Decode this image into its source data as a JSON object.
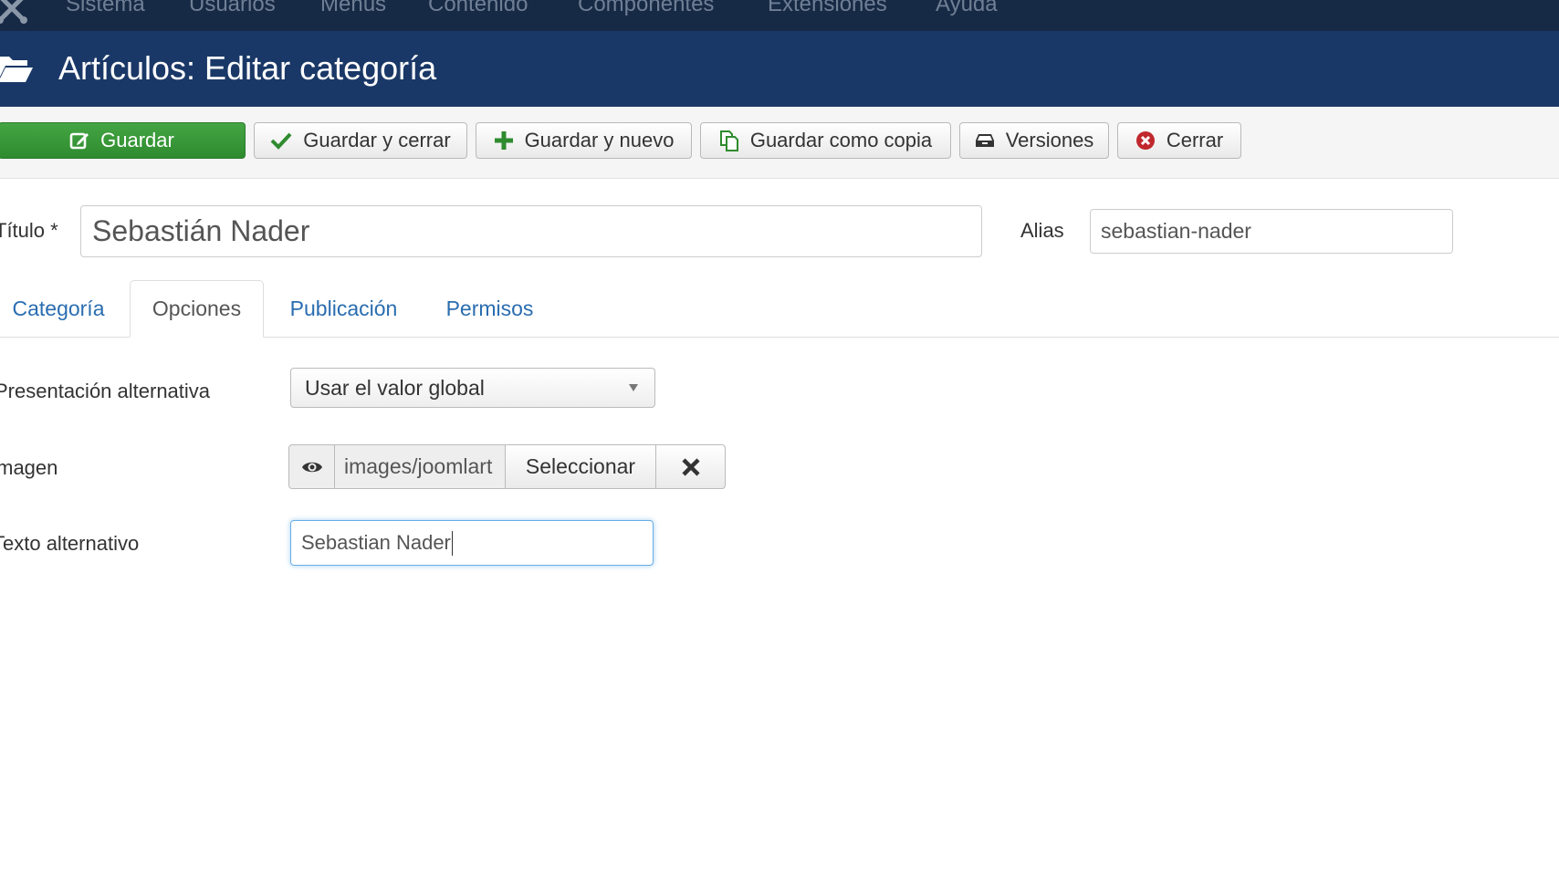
{
  "topnav": {
    "items": [
      "Sistema",
      "Usuarios",
      "Menús",
      "Contenido",
      "Componentes",
      "Extensiones",
      "Ayuda"
    ]
  },
  "header": {
    "title": "Artículos: Editar categoría"
  },
  "toolbar": {
    "save": "Guardar",
    "save_close": "Guardar y cerrar",
    "save_new": "Guardar y nuevo",
    "save_copy": "Guardar como copia",
    "versions": "Versiones",
    "close": "Cerrar"
  },
  "form": {
    "title_label": "Título *",
    "title_value": "Sebastián Nader",
    "alias_label": "Alias",
    "alias_value": "sebastian-nader"
  },
  "tabs": [
    "Categoría",
    "Opciones",
    "Publicación",
    "Permisos"
  ],
  "active_tab": "Opciones",
  "options": {
    "layout_label": "Presentación alternativa",
    "layout_value": "Usar el valor global",
    "image_label": "Imagen",
    "image_path": "images/joomlart",
    "image_select": "Seleccionar",
    "alt_label": "Texto alternativo",
    "alt_value": "Sebastian Nader"
  },
  "colors": {
    "topnav_bg": "#172a45",
    "header_bg": "#1a3867",
    "save_green": "#3a9a3a",
    "link_blue": "#2a6db0",
    "close_red": "#c0282d"
  }
}
